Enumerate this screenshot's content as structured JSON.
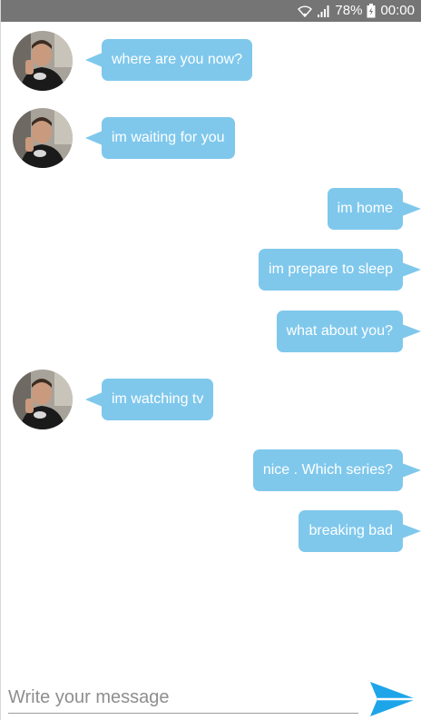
{
  "status_bar": {
    "battery_percent": "78%",
    "time": "00:00",
    "icons": [
      "wifi-icon",
      "signal-icon",
      "battery-icon"
    ]
  },
  "colors": {
    "bubble": "#7fc8ec",
    "bubble_text": "#ffffff",
    "status_bar": "#757575",
    "send_icon": "#1ea5e9"
  },
  "messages": [
    {
      "side": "incoming",
      "text": "where are you now?"
    },
    {
      "side": "incoming",
      "text": "im waiting for you"
    },
    {
      "side": "outgoing",
      "text": "im home"
    },
    {
      "side": "outgoing",
      "text": "im prepare to sleep"
    },
    {
      "side": "outgoing",
      "text": "what about you?"
    },
    {
      "side": "incoming",
      "text": "im watching tv"
    },
    {
      "side": "outgoing",
      "text": "nice . Which series?"
    },
    {
      "side": "outgoing",
      "text": "breaking bad"
    }
  ],
  "composer": {
    "placeholder": "Write your message",
    "value": "",
    "send_icon": "send-icon"
  }
}
